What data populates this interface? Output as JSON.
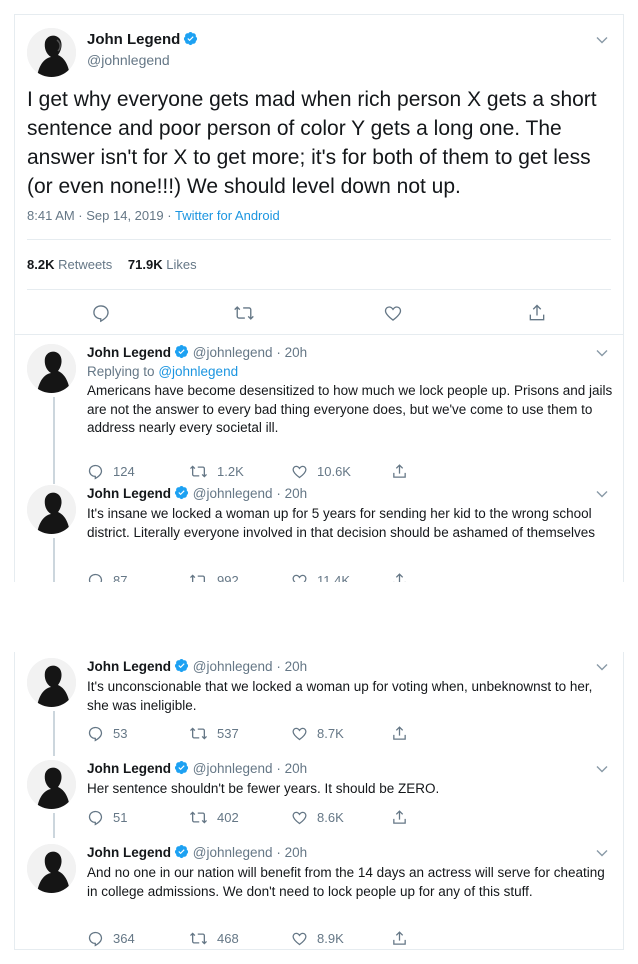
{
  "main_tweet": {
    "author_name": "John Legend",
    "author_handle": "@johnlegend",
    "text": "I get why everyone gets mad when rich person X gets a short sentence and poor person of color Y gets a long one. The answer isn't for X to get more; it's for both of them to get less (or even none!!!) We should level down not up.",
    "timestamp": "8:41 AM · Sep 14, 2019",
    "separator": "·",
    "source": "Twitter for Android",
    "retweets": "8.2K",
    "retweets_label": "Retweets",
    "likes": "71.9K",
    "likes_label": "Likes"
  },
  "replies": [
    {
      "name": "John Legend",
      "handle": "@johnlegend",
      "dot": "·",
      "time": "20h",
      "replying_prefix": "Replying to",
      "replying_to": "@johnlegend",
      "text": "Americans have become desensitized to how much we lock people up.  Prisons and jails are not the answer to every bad thing everyone does, but we've come to use them to address nearly every societal ill.",
      "replies": "124",
      "retweets": "1.2K",
      "likes": "10.6K"
    },
    {
      "name": "John Legend",
      "handle": "@johnlegend",
      "dot": "·",
      "time": "20h",
      "text": "It's insane we locked a woman up for 5 years for sending her kid to the wrong school district. Literally everyone involved in that decision should be ashamed of themselves",
      "replies": "87",
      "retweets": "992",
      "likes": "11.4K"
    },
    {
      "name": "John Legend",
      "handle": "@johnlegend",
      "dot": "·",
      "time": "20h",
      "text": "It's unconscionable that we locked a woman up for voting when, unbeknownst to her, she was ineligible.",
      "replies": "53",
      "retweets": "537",
      "likes": "8.7K"
    },
    {
      "name": "John Legend",
      "handle": "@johnlegend",
      "dot": "·",
      "time": "20h",
      "text": "Her sentence shouldn't be fewer years. It should be ZERO.",
      "replies": "51",
      "retweets": "402",
      "likes": "8.6K"
    },
    {
      "name": "John Legend",
      "handle": "@johnlegend",
      "dot": "·",
      "time": "20h",
      "text": "And no one in our nation will benefit from the 14 days an actress will serve for cheating in college admissions. We don't need to lock people up for any of this stuff.",
      "replies": "364",
      "retweets": "468",
      "likes": "8.9K"
    }
  ],
  "icons": {
    "verified": "verified-badge-icon",
    "more": "chevron-down-icon",
    "reply": "reply-icon",
    "retweet": "retweet-icon",
    "like": "like-icon",
    "share": "share-icon"
  },
  "colors": {
    "link": "#1b95e0",
    "secondary_text": "#657786",
    "primary_text": "#14171a",
    "divider": "#e6ecf0",
    "thread_line": "#ccd6dd"
  }
}
